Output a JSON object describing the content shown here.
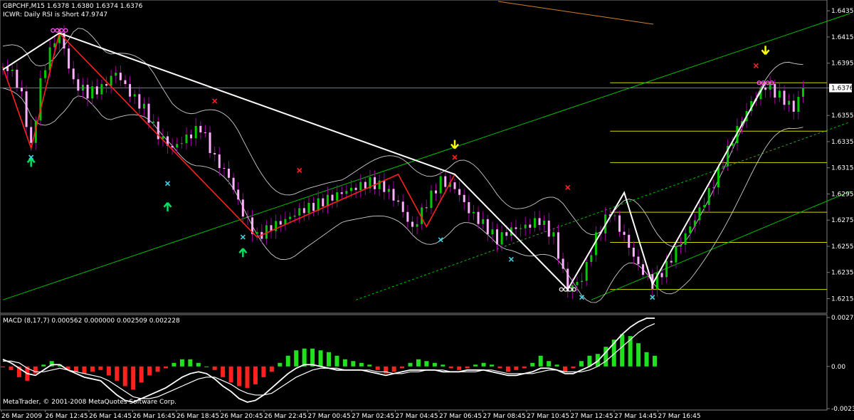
{
  "window": {
    "main_title": "GBPCHF,M15  1.6378 1.6380 1.6374 1.6376",
    "main_subtitle": "ICWR: Daily RSI is Short 47.9747",
    "macd_title": "MACD  (8,17,7) 0.000562 0.000000 0.002509 0.002228",
    "copyright": "MetaTrader, © 2001-2008 MetaQuotes Software Corp."
  },
  "colors": {
    "background": "#000000",
    "grid": "#7f7f7f",
    "bull_candle": "#00c800",
    "bear_candle": "#ffb0ff",
    "wick": "#a000a0",
    "zigzag_red": "#ff2020",
    "zigzag_white": "#ffffff",
    "channel_green": "#00c000",
    "fib_yellow": "#d4d400",
    "bands": "#cccccc",
    "macd_pos": "#20e020",
    "macd_neg": "#ff2020",
    "macd_lines": "#ffffff",
    "arrow_up": "#00e060",
    "arrow_down": "#ffff00",
    "x_red": "#ff2020",
    "x_cyan": "#40d0e0",
    "ma_orange": "#d08030"
  },
  "chart_data": {
    "type": "candlestick",
    "symbol": "GBPCHF",
    "timeframe": "M15",
    "current_price": "1.6376",
    "price_axis_labels": [
      "1.6435",
      "1.6415",
      "1.6395",
      "1.6376",
      "1.6355",
      "1.6335",
      "1.6315",
      "1.6295",
      "1.6275",
      "1.6255",
      "1.6235",
      "1.6215"
    ],
    "price_axis_values": [
      1.6435,
      1.6415,
      1.6395,
      1.6376,
      1.6355,
      1.6335,
      1.6315,
      1.6295,
      1.6275,
      1.6255,
      1.6235,
      1.6215
    ],
    "ylim": [
      1.6206,
      1.644
    ],
    "macd_axis_labels": [
      "0.00274",
      "0.00",
      "-0.00236"
    ],
    "macd_axis_values": [
      0.00274,
      0.0,
      -0.00236
    ],
    "macd_ylim": [
      -0.00236,
      0.00274
    ],
    "time_axis_labels": [
      "26 Mar 2009",
      "26 Mar 12:45",
      "26 Mar 14:45",
      "26 Mar 16:45",
      "26 Mar 18:45",
      "26 Mar 20:45",
      "26 Mar 22:45",
      "27 Mar 00:45",
      "27 Mar 02:45",
      "27 Mar 04:45",
      "27 Mar 06:45",
      "27 Mar 08:45",
      "27 Mar 10:45",
      "27 Mar 12:45",
      "27 Mar 14:45",
      "27 Mar 16:45"
    ],
    "close_path": [
      [
        0,
        1.6392
      ],
      [
        4,
        1.6388
      ],
      [
        8,
        1.637
      ],
      [
        12,
        1.633
      ],
      [
        16,
        1.638
      ],
      [
        20,
        1.6405
      ],
      [
        24,
        1.6418
      ],
      [
        30,
        1.638
      ],
      [
        36,
        1.6372
      ],
      [
        42,
        1.6376
      ],
      [
        48,
        1.6388
      ],
      [
        54,
        1.6372
      ],
      [
        60,
        1.636
      ],
      [
        66,
        1.634
      ],
      [
        72,
        1.633
      ],
      [
        78,
        1.6338
      ],
      [
        84,
        1.6346
      ],
      [
        90,
        1.6322
      ],
      [
        96,
        1.6308
      ],
      [
        102,
        1.628
      ],
      [
        108,
        1.6262
      ],
      [
        114,
        1.627
      ],
      [
        120,
        1.6275
      ],
      [
        126,
        1.6282
      ],
      [
        132,
        1.6286
      ],
      [
        138,
        1.6291
      ],
      [
        144,
        1.6296
      ],
      [
        150,
        1.63
      ],
      [
        156,
        1.6304
      ],
      [
        162,
        1.63
      ],
      [
        168,
        1.6288
      ],
      [
        174,
        1.6268
      ],
      [
        180,
        1.6288
      ],
      [
        186,
        1.6305
      ],
      [
        192,
        1.63
      ],
      [
        198,
        1.6282
      ],
      [
        204,
        1.6272
      ],
      [
        210,
        1.626
      ],
      [
        216,
        1.6268
      ],
      [
        222,
        1.627
      ],
      [
        228,
        1.6275
      ],
      [
        234,
        1.6262
      ],
      [
        240,
        1.6222
      ],
      [
        246,
        1.623
      ],
      [
        252,
        1.6262
      ],
      [
        258,
        1.6282
      ],
      [
        264,
        1.6262
      ],
      [
        270,
        1.624
      ],
      [
        276,
        1.6226
      ],
      [
        282,
        1.624
      ],
      [
        288,
        1.6258
      ],
      [
        294,
        1.6276
      ],
      [
        300,
        1.6296
      ],
      [
        306,
        1.632
      ],
      [
        312,
        1.6345
      ],
      [
        318,
        1.6365
      ],
      [
        324,
        1.6378
      ],
      [
        330,
        1.637
      ],
      [
        336,
        1.636
      ],
      [
        340,
        1.6376
      ]
    ],
    "zigzag_red": [
      [
        0,
        1.6392
      ],
      [
        12,
        1.633
      ],
      [
        24,
        1.6418
      ],
      [
        108,
        1.6262
      ],
      [
        168,
        1.631
      ],
      [
        180,
        1.627
      ],
      [
        192,
        1.631
      ],
      [
        240,
        1.6222
      ],
      [
        264,
        1.6296
      ],
      [
        276,
        1.6226
      ]
    ],
    "zigzag_white": [
      [
        0,
        1.639
      ],
      [
        24,
        1.6418
      ],
      [
        192,
        1.631
      ],
      [
        240,
        1.6222
      ],
      [
        264,
        1.6296
      ],
      [
        276,
        1.6226
      ],
      [
        324,
        1.638
      ]
    ],
    "channel_lines": [
      {
        "from": [
          0,
          1.6214
        ],
        "to": [
          360,
          1.6433
        ]
      },
      {
        "from": [
          150,
          1.6214
        ],
        "to": [
          360,
          1.635
        ]
      },
      {
        "from": [
          250,
          1.6214
        ],
        "to": [
          360,
          1.6297
        ]
      }
    ],
    "fib_levels": [
      1.638,
      1.6343,
      1.6319,
      1.6281,
      1.6258,
      1.6222
    ],
    "markers": {
      "arrows_up": [
        [
          12,
          1.6319
        ],
        [
          70,
          1.6285
        ],
        [
          102,
          1.625
        ]
      ],
      "arrows_down": [
        [
          192,
          1.6333
        ],
        [
          324,
          1.6405
        ]
      ],
      "x_red": [
        [
          24,
          1.642
        ],
        [
          90,
          1.6366
        ],
        [
          126,
          1.6313
        ],
        [
          192,
          1.6323
        ],
        [
          240,
          1.63
        ],
        [
          320,
          1.6393
        ]
      ],
      "x_cyan": [
        [
          12,
          1.6323
        ],
        [
          70,
          1.6303
        ],
        [
          102,
          1.6262
        ],
        [
          186,
          1.626
        ],
        [
          216,
          1.6245
        ],
        [
          246,
          1.6216
        ],
        [
          276,
          1.6216
        ]
      ],
      "circles": [
        [
          24,
          1.642
        ],
        [
          240,
          1.6222
        ],
        [
          324,
          1.638
        ]
      ]
    },
    "macd_hist": [
      -5e-05,
      -0.0002,
      -0.0006,
      -0.0008,
      -0.0004,
      0.0001,
      0.0003,
      0.0001,
      -0.0002,
      -0.0003,
      -0.0004,
      -0.0003,
      -0.0002,
      -0.0005,
      -0.0008,
      -0.0011,
      -0.0013,
      -0.0009,
      -0.0005,
      -0.0003,
      -0.0001,
      0.0002,
      0.0004,
      0.0004,
      0.0002,
      0.0,
      -0.0002,
      -0.0006,
      -0.0009,
      -0.0011,
      -0.0012,
      -0.001,
      -0.0006,
      -0.0003,
      0.0002,
      0.0006,
      0.0009,
      0.001,
      0.001,
      0.0009,
      0.0008,
      0.0006,
      0.0004,
      0.0003,
      0.0002,
      0.0001,
      -0.0002,
      -0.0004,
      -0.0003,
      -0.0001,
      0.0002,
      0.0004,
      0.0003,
      0.0002,
      0.0001,
      -0.0001,
      -0.0002,
      -0.0001,
      0.0001,
      0.0002,
      0.0001,
      -0.0001,
      -0.0003,
      -0.0002,
      -0.0001,
      0.0002,
      0.0006,
      0.0003,
      0.0001,
      -0.0003,
      -0.0001,
      0.0003,
      0.0006,
      0.0007,
      0.0011,
      0.0015,
      0.0018,
      0.0017,
      0.0013,
      0.0008,
      0.0006
    ],
    "macd_line": [
      0.0004,
      0.0002,
      -0.0001,
      -0.0004,
      -0.0005,
      -0.0002,
      0.0001,
      0.0001,
      -0.0002,
      -0.0004,
      -0.0006,
      -0.0007,
      -0.0008,
      -0.0012,
      -0.0016,
      -0.0019,
      -0.002,
      -0.0018,
      -0.0016,
      -0.0014,
      -0.0012,
      -0.0009,
      -0.0006,
      -0.0004,
      -0.0003,
      -0.0004,
      -0.0007,
      -0.0011,
      -0.0014,
      -0.0018,
      -0.002,
      -0.0019,
      -0.0016,
      -0.0012,
      -0.0008,
      -0.0004,
      -0.0001,
      0.0001,
      0.0001,
      0.0,
      -0.0001,
      -0.0002,
      -0.0002,
      -0.0002,
      -0.0002,
      -0.0003,
      -0.0004,
      -0.0005,
      -0.0004,
      -0.0003,
      -0.0002,
      -0.0002,
      -0.0002,
      -0.0002,
      -0.0003,
      -0.0003,
      -0.0003,
      -0.0002,
      -0.0002,
      -0.0002,
      -0.0003,
      -0.0004,
      -0.0005,
      -0.0005,
      -0.0004,
      -0.0003,
      -0.0001,
      -0.0001,
      -0.0002,
      -0.0004,
      -0.0004,
      -0.0002,
      0.0,
      0.0003,
      0.0008,
      0.0013,
      0.0018,
      0.0022,
      0.0025,
      0.0027,
      0.0027
    ],
    "macd_signal": [
      0.0003,
      0.0003,
      0.0002,
      -0.0001,
      -0.0003,
      -0.0003,
      -0.0002,
      -0.0001,
      -0.0002,
      -0.0003,
      -0.0004,
      -0.0005,
      -0.0006,
      -0.0008,
      -0.0011,
      -0.0014,
      -0.0017,
      -0.0018,
      -0.0018,
      -0.0017,
      -0.0015,
      -0.0013,
      -0.0011,
      -0.0009,
      -0.0007,
      -0.0006,
      -0.0006,
      -0.0008,
      -0.001,
      -0.0013,
      -0.0015,
      -0.0016,
      -0.0016,
      -0.0015,
      -0.0012,
      -0.0009,
      -0.0006,
      -0.0004,
      -0.0002,
      -0.0001,
      -0.0001,
      -0.0001,
      -0.0002,
      -0.0002,
      -0.0002,
      -0.0002,
      -0.0003,
      -0.0003,
      -0.0004,
      -0.0004,
      -0.0003,
      -0.0003,
      -0.0002,
      -0.0002,
      -0.0002,
      -0.0003,
      -0.0003,
      -0.0003,
      -0.0003,
      -0.0002,
      -0.0002,
      -0.0003,
      -0.0004,
      -0.0004,
      -0.0004,
      -0.0004,
      -0.0003,
      -0.0002,
      -0.0002,
      -0.0003,
      -0.0003,
      -0.0003,
      -0.0002,
      0.0,
      0.0003,
      0.0007,
      0.0011,
      0.0015,
      0.0019,
      0.0022,
      0.0024
    ]
  }
}
